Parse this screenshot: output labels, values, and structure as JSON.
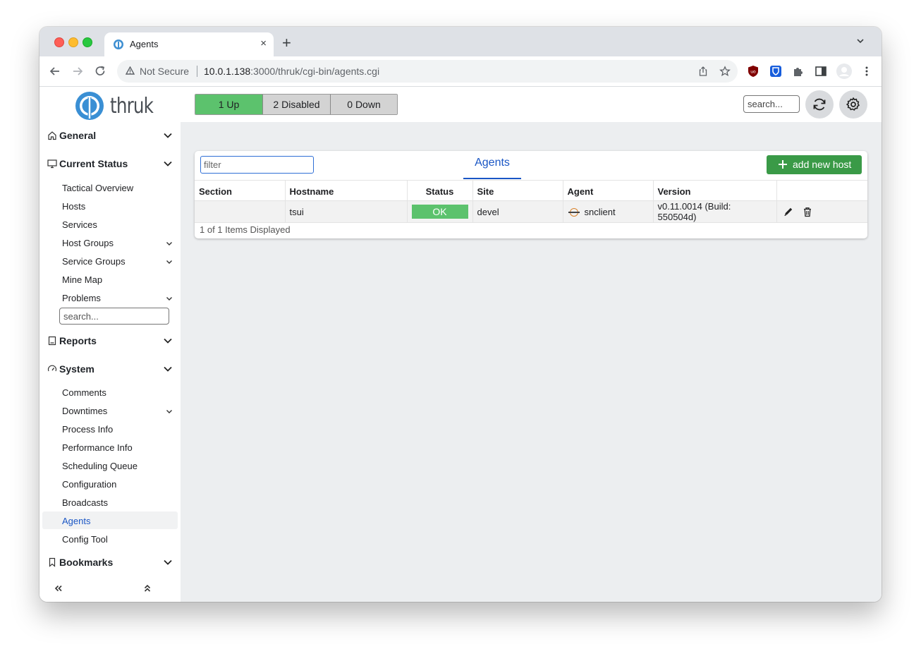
{
  "browser": {
    "tab_title": "Agents",
    "tab_close": "×",
    "new_tab": "+",
    "not_secure": "Not Secure",
    "url_host": "10.0.1.138",
    "url_rest": ":3000/thruk/cgi-bin/agents.cgi"
  },
  "logo": {
    "text": "thruk"
  },
  "header": {
    "status": {
      "up": "1 Up",
      "disabled": "2 Disabled",
      "down": "0 Down"
    },
    "search_placeholder": "search..."
  },
  "sidebar": {
    "general": "General",
    "current_status": "Current Status",
    "current_status_items": [
      "Tactical Overview",
      "Hosts",
      "Services",
      "Host Groups",
      "Service Groups",
      "Mine Map",
      "Problems"
    ],
    "search_placeholder": "search...",
    "reports": "Reports",
    "system": "System",
    "system_items": [
      "Comments",
      "Downtimes",
      "Process Info",
      "Performance Info",
      "Scheduling Queue",
      "Configuration",
      "Broadcasts",
      "Agents",
      "Config Tool"
    ],
    "bookmarks": "Bookmarks",
    "collapse_left": "«",
    "collapse_up": "⌃"
  },
  "panel": {
    "filter_placeholder": "filter",
    "title": "Agents",
    "add_button": "add new host",
    "columns": [
      "Section",
      "Hostname",
      "Status",
      "Site",
      "Agent",
      "Version"
    ],
    "rows": [
      {
        "section": "",
        "hostname": "tsui",
        "status": "OK",
        "site": "devel",
        "agent": "snclient",
        "version": "v0.11.0014 (Build: 550504d)"
      }
    ],
    "count": "1 of 1 Items Displayed"
  },
  "colors": {
    "ok": "#5cc26d",
    "add": "#3a9a47",
    "link": "#1a56c5"
  }
}
